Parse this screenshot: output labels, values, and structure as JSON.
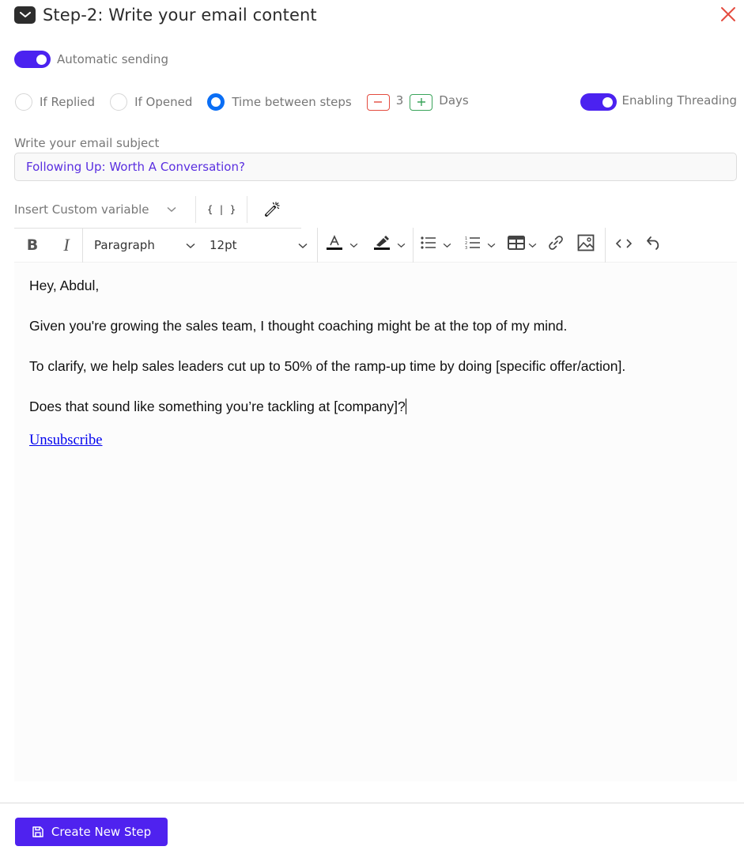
{
  "header": {
    "title": "Step-2:  Write your email content",
    "icon": "mail-icon",
    "close_icon": "close-icon"
  },
  "automatic_sending": {
    "label": "Automatic sending",
    "enabled": true
  },
  "conditions": {
    "options": [
      {
        "label": "If Replied",
        "selected": false
      },
      {
        "label": "If Opened",
        "selected": false
      },
      {
        "label": "Time between steps",
        "selected": true
      }
    ],
    "stepper": {
      "value": "3",
      "unit": "Days",
      "minus_label": "−",
      "plus_label": "+"
    }
  },
  "threading": {
    "label": "Enabling Threading",
    "enabled": true
  },
  "subject": {
    "label": "Write your email subject",
    "value": "Following Up: Worth A Conversation?"
  },
  "variables": {
    "select_label": "Insert Custom variable",
    "variable_button": "{ | }",
    "ai_icon": "magic-wand-icon"
  },
  "toolbar": {
    "bold": "B",
    "italic": "I",
    "block_format": "Paragraph",
    "font_size": "12pt",
    "text_color_glyph": "A"
  },
  "email_body": {
    "paragraphs": [
      "Hey, Abdul,",
      "Given you're growing the sales team, I thought coaching might be at the top of my mind.",
      "To clarify, we help sales leaders cut up to 50% of the ramp-up time by doing [specific offer/action].",
      "Does that sound like something you’re tackling at [company]?"
    ],
    "unsubscribe_link": "Unsubscribe"
  },
  "footer": {
    "create_button": "Create New Step"
  },
  "colors": {
    "accent": "#4f22ef",
    "radio_selected": "#0a6ef5",
    "danger": "#e44b3f",
    "success": "#3aa45a",
    "subject_text": "#5a2fe0"
  }
}
